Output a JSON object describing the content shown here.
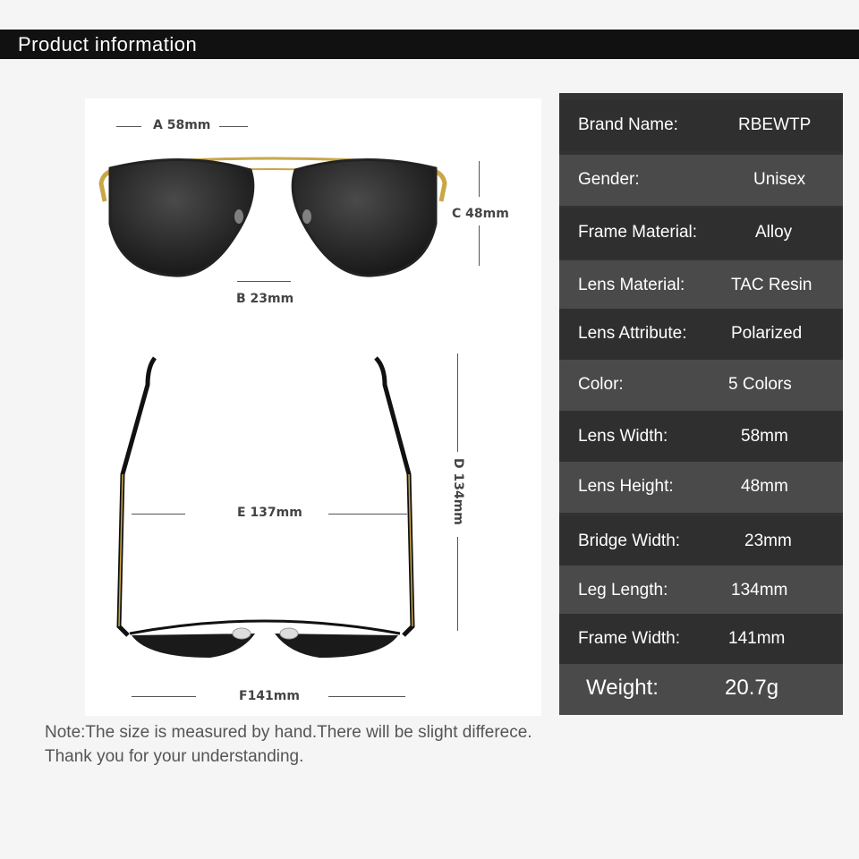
{
  "header": {
    "title": "Product information"
  },
  "dimensions": {
    "a": "A 58mm",
    "b": "B 23mm",
    "c": "C 48mm",
    "d": "D 134mm",
    "e": "E 137mm",
    "f": "F141mm"
  },
  "specs": [
    {
      "label": "Brand Name:",
      "value": "RBEWTP"
    },
    {
      "label": "Gender:",
      "value": "Unisex"
    },
    {
      "label": "Frame Material:",
      "value": "Alloy"
    },
    {
      "label": "Lens Material:",
      "value": "TAC Resin"
    },
    {
      "label": "Lens Attribute:",
      "value": "Polarized"
    },
    {
      "label": "Color:",
      "value": "5 Colors"
    },
    {
      "label": "Lens Width:",
      "value": "58mm"
    },
    {
      "label": "Lens Height:",
      "value": "48mm"
    },
    {
      "label": "Bridge Width:",
      "value": "23mm"
    },
    {
      "label": "Leg Length:",
      "value": "134mm"
    },
    {
      "label": "Frame Width:",
      "value": "141mm"
    },
    {
      "label": "Weight:",
      "value": "20.7g"
    }
  ],
  "note": {
    "line1": "Note:The size is measured by hand.There will be slight differece.",
    "line2": "Thank you for your understanding."
  },
  "colors": {
    "frame_gold": "#c9a646",
    "lens": "#1c1c1c",
    "header_bg": "#111111"
  }
}
